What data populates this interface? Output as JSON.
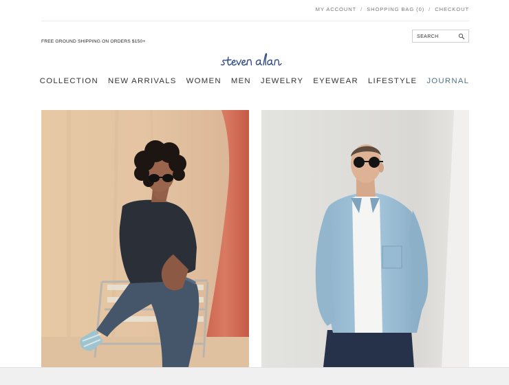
{
  "utility_nav": {
    "account": "MY ACCOUNT",
    "separator": "/",
    "shopping_bag": "SHOPPING BAG (0)",
    "checkout": "CHECKOUT"
  },
  "search": {
    "placeholder": "SEARCH",
    "icon": "magnifier"
  },
  "promo": "FREE GROUND SHIPPING ON ORDERS $150+",
  "brand": {
    "logo_text": "steven alan",
    "color": "#2f4a86"
  },
  "main_nav": {
    "items": [
      "COLLECTION",
      "NEW ARRIVALS",
      "WOMEN",
      "MEN",
      "JEWELRY",
      "EYEWEAR",
      "LIFESTYLE",
      "JOURNAL"
    ],
    "active_color": "#4f7387"
  },
  "hero": {
    "left": {
      "subject": "woman in sunglasses seated on a folding chair"
    },
    "right": {
      "subject": "man in sunglasses wearing a light blue shirt"
    }
  }
}
